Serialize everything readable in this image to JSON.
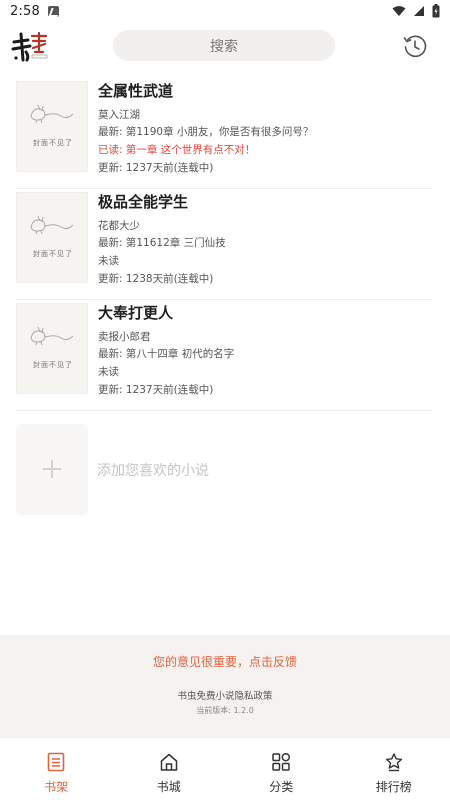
{
  "status_bar": {
    "time": "2:58"
  },
  "header": {
    "logo_text": "书架",
    "search_placeholder": "搜索"
  },
  "books": [
    {
      "cover_text": "封面不见了",
      "title": "全属性武道",
      "author": "莫入江湖",
      "latest": "最新: 第1190章 小朋友，你是否有很多问号？",
      "read": "已读: 第一章 这个世界有点不对！",
      "read_highlight": true,
      "updated": "更新: 1237天前(连载中)"
    },
    {
      "cover_text": "封面不见了",
      "title": "极品全能学生",
      "author": "花都大少",
      "latest": "最新: 第11612章 三门仙技",
      "read": "未读",
      "read_highlight": false,
      "updated": "更新: 1238天前(连载中)"
    },
    {
      "cover_text": "封面不见了",
      "title": "大奉打更人",
      "author": "卖报小郎君",
      "latest": "最新: 第八十四章 初代的名字",
      "read": "未读",
      "read_highlight": false,
      "updated": "更新: 1237天前(连载中)"
    }
  ],
  "add_book": {
    "label": "添加您喜欢的小说"
  },
  "footer": {
    "feedback": "您的意见很重要，点击反馈",
    "privacy": "书虫免费小说隐私政策",
    "version": "当前版本: 1.2.0"
  },
  "nav": [
    {
      "label": "书架",
      "icon": "bookshelf-icon",
      "active": true
    },
    {
      "label": "书城",
      "icon": "home-icon",
      "active": false
    },
    {
      "label": "分类",
      "icon": "category-icon",
      "active": false
    },
    {
      "label": "排行榜",
      "icon": "ranking-icon",
      "active": false
    }
  ],
  "colors": {
    "accent": "#e4613d",
    "read_red": "#e64338",
    "footer_bg": "#f5f2ef"
  }
}
